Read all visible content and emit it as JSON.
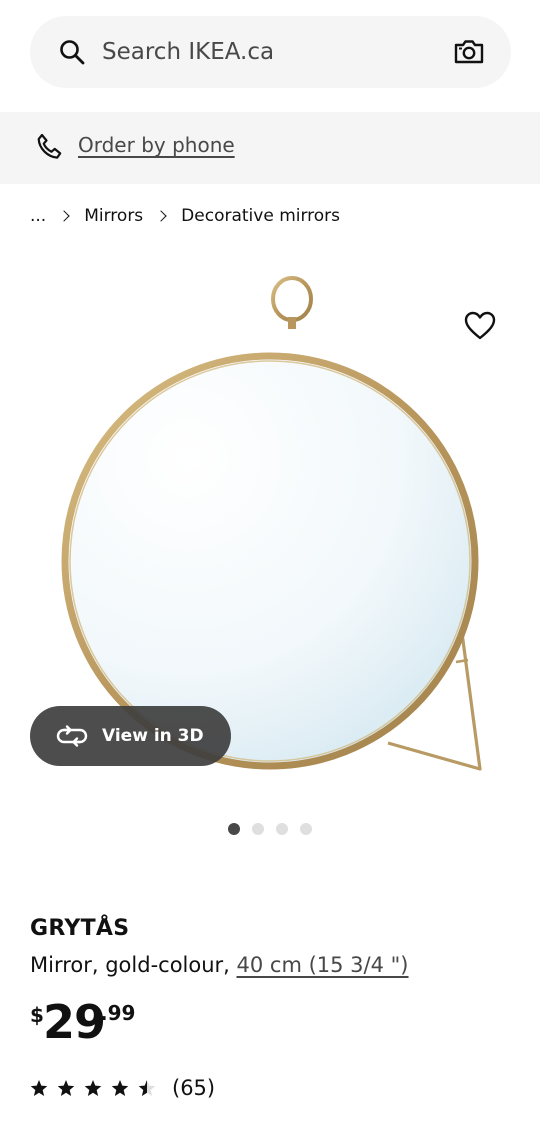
{
  "search": {
    "placeholder": "Search IKEA.ca"
  },
  "phone_bar": {
    "link_label": "Order by phone"
  },
  "breadcrumb": {
    "ellipsis": "...",
    "items": [
      "Mirrors",
      "Decorative mirrors"
    ]
  },
  "gallery": {
    "view_3d_label": "View in 3D",
    "image_count": 4,
    "active_index": 0
  },
  "product": {
    "name": "GRYTÅS",
    "description": "Mirror, gold-colour, ",
    "size_link": "40 cm (15 3/4 \")",
    "price": {
      "currency": "$",
      "integer": "29",
      "decimal": ".99"
    },
    "rating": {
      "stars": 4.5,
      "max": 5,
      "count": "(65)"
    }
  },
  "icons": {
    "search": "search-icon",
    "camera": "camera-icon",
    "phone": "phone-icon",
    "favorite": "heart-icon",
    "view_3d": "rotate-3d-icon",
    "star": "star-icon"
  },
  "colors": {
    "search_bg": "#f5f5f5",
    "banner_bg": "#f5f5f5",
    "text": "#111111",
    "link": "#484848",
    "view3d_bg": "#404040",
    "dot_active": "#484848",
    "dot_inactive": "#dfdfdf",
    "mirror_frame": "#c8a96e"
  }
}
